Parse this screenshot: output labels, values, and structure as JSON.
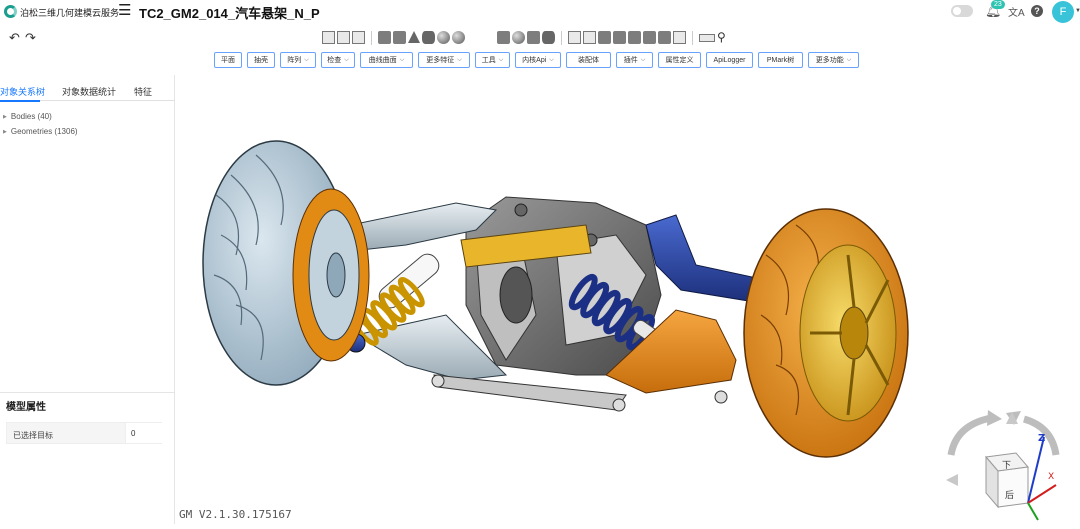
{
  "app": {
    "brand": "泊松三维几何建模云服务",
    "title": "TC2_GM2_014_汽车悬架_N_P",
    "notification_count": "23",
    "avatar_initial": "F"
  },
  "icons": {
    "logo": "logo-ring-icon",
    "menu": "list-menu-icon",
    "notification": "bell-icon",
    "translate": "translate-icon",
    "help": "question-icon",
    "undo": "undo-icon",
    "redo": "redo-icon",
    "search": "search-icon"
  },
  "toolbar": {
    "buttons": [
      {
        "label": "平面",
        "dropdown": false
      },
      {
        "label": "抽壳",
        "dropdown": false
      },
      {
        "label": "阵列",
        "dropdown": true
      },
      {
        "label": "检查",
        "dropdown": true
      },
      {
        "label": "曲线曲面",
        "dropdown": true
      },
      {
        "label": "更多特征",
        "dropdown": true
      },
      {
        "label": "工具",
        "dropdown": true
      },
      {
        "label": "内核Api",
        "dropdown": true
      },
      {
        "label": "装配体",
        "dropdown": false
      },
      {
        "label": "插件",
        "dropdown": true
      },
      {
        "label": "属性定义",
        "dropdown": false
      },
      {
        "label": "ApiLogger",
        "dropdown": false
      },
      {
        "label": "PMark树",
        "dropdown": false
      },
      {
        "label": "更多功能",
        "dropdown": true
      }
    ]
  },
  "left_panel": {
    "tabs": [
      "对象关系树",
      "对象数据统计",
      "特征"
    ],
    "active_tab": "对象关系树",
    "tree": [
      {
        "label": "Bodies (40)"
      },
      {
        "label": "Geometries (1306)"
      }
    ],
    "properties_title": "模型属性",
    "properties": [
      {
        "label": "已选择目标",
        "value": "0"
      }
    ]
  },
  "viewport": {
    "version": "GM V2.1.30.175167",
    "view_cube": {
      "top_face": "下",
      "front_face": "后"
    },
    "axes": [
      "Z",
      "X"
    ],
    "colors": {
      "left_wheel": "#b8ccd8",
      "right_wheel": "#e6961e",
      "rim_gold": "#e8b930",
      "arm_blue": "#2745a5",
      "spring_yellow": "#f2c62a",
      "body_grey": "#777777",
      "axis_z": "#1e3cc8",
      "axis_x": "#d21e1e",
      "axis_y": "#1ea01e"
    }
  }
}
